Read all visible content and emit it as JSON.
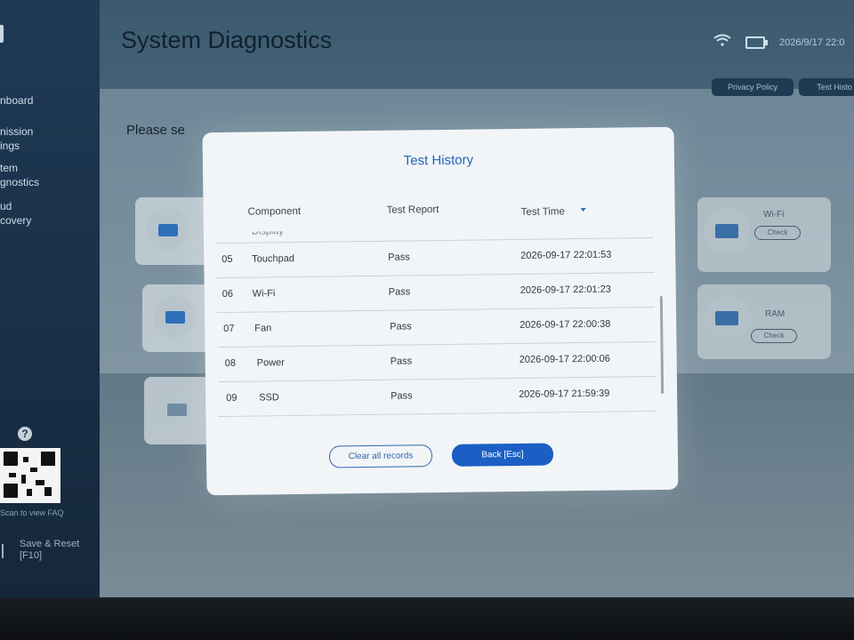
{
  "app": {
    "title": "System Diagnostics",
    "datetime": "2026/9/17 22:0",
    "prompt_partial": "Please se",
    "privacy_label": "Privacy Policy",
    "history_label": "Test Histo"
  },
  "sidebar": {
    "items": [
      {
        "label": "nboard"
      },
      {
        "label": "nission\nings"
      },
      {
        "label": "tem\ngnostics"
      },
      {
        "label": "ud\ncovery"
      }
    ],
    "faq_label": "Scan to view FAQ",
    "save_reset": "Save & Reset\n[F10]"
  },
  "background_cards": {
    "wifi": {
      "label": "Wi-Fi",
      "check": "Check"
    },
    "ram": {
      "label": "RAM",
      "check": "Check"
    }
  },
  "modal": {
    "title": "Test History",
    "columns": {
      "component": "Component",
      "report": "Test Report",
      "time": "Test Time"
    },
    "partial_row": "Display",
    "rows": [
      {
        "num": "05",
        "component": "Touchpad",
        "report": "Pass",
        "time": "2026-09-17 22:01:53"
      },
      {
        "num": "06",
        "component": "Wi-Fi",
        "report": "Pass",
        "time": "2026-09-17 22:01:23"
      },
      {
        "num": "07",
        "component": "Fan",
        "report": "Pass",
        "time": "2026-09-17 22:00:38"
      },
      {
        "num": "08",
        "component": "Power",
        "report": "Pass",
        "time": "2026-09-17 22:00:06"
      },
      {
        "num": "09",
        "component": "SSD",
        "report": "Pass",
        "time": "2026-09-17 21:59:39"
      }
    ],
    "buttons": {
      "clear": "Clear all records",
      "back": "Back [Esc]"
    }
  },
  "colors": {
    "accent": "#1b5fc4",
    "title_blue": "#2363b8"
  }
}
